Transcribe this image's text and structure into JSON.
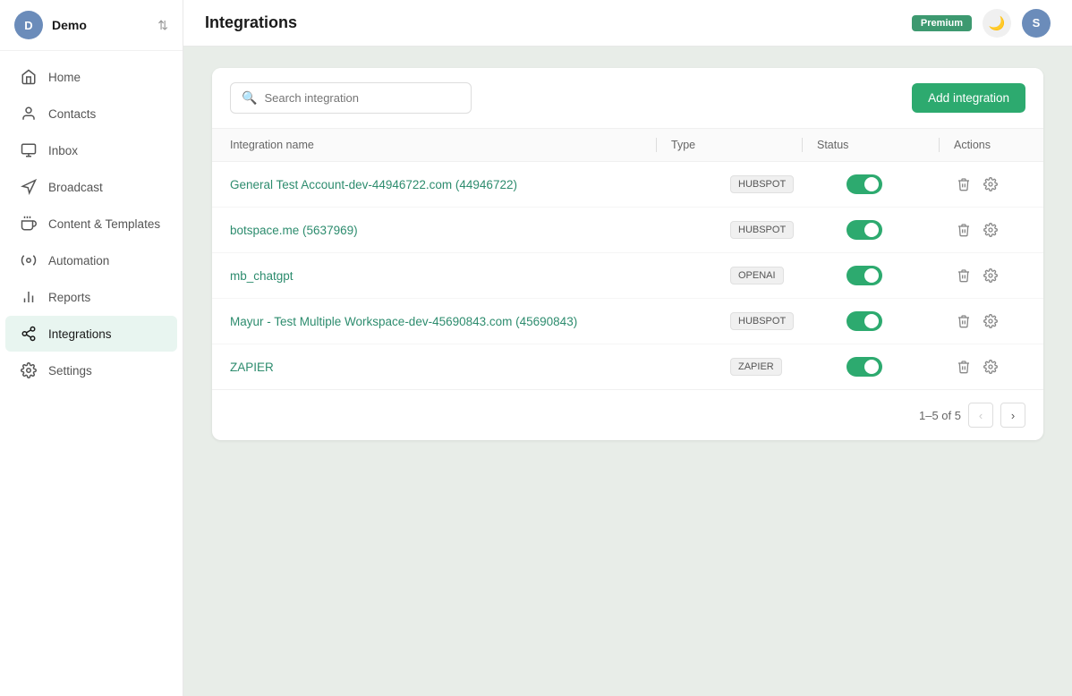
{
  "app": {
    "workspace": "Demo",
    "workspace_initial": "D",
    "user_initial": "S",
    "premium_label": "Premium",
    "page_title": "Integrations"
  },
  "sidebar": {
    "items": [
      {
        "id": "home",
        "label": "Home",
        "icon": "🏠"
      },
      {
        "id": "contacts",
        "label": "Contacts",
        "icon": "👤"
      },
      {
        "id": "inbox",
        "label": "Inbox",
        "icon": "🖥"
      },
      {
        "id": "broadcast",
        "label": "Broadcast",
        "icon": "📡"
      },
      {
        "id": "content-templates",
        "label": "Content & Templates",
        "icon": "🔔"
      },
      {
        "id": "automation",
        "label": "Automation",
        "icon": "🔔"
      },
      {
        "id": "reports",
        "label": "Reports",
        "icon": "📊"
      },
      {
        "id": "integrations",
        "label": "Integrations",
        "icon": "🔗"
      },
      {
        "id": "settings",
        "label": "Settings",
        "icon": "⚙️"
      }
    ]
  },
  "toolbar": {
    "search_placeholder": "Search integration",
    "add_button_label": "Add integration"
  },
  "table": {
    "columns": {
      "name": "Integration name",
      "type": "Type",
      "status": "Status",
      "actions": "Actions"
    },
    "rows": [
      {
        "name": "General Test Account-dev-44946722.com (44946722)",
        "type": "HUBSPOT",
        "enabled": true
      },
      {
        "name": "botspace.me (5637969)",
        "type": "HUBSPOT",
        "enabled": true
      },
      {
        "name": "mb_chatgpt",
        "type": "OPENAI",
        "enabled": true
      },
      {
        "name": "Mayur - Test Multiple Workspace-dev-45690843.com (45690843)",
        "type": "HUBSPOT",
        "enabled": true
      },
      {
        "name": "ZAPIER",
        "type": "ZAPIER",
        "enabled": true
      }
    ]
  },
  "pagination": {
    "info": "1–5 of 5"
  }
}
